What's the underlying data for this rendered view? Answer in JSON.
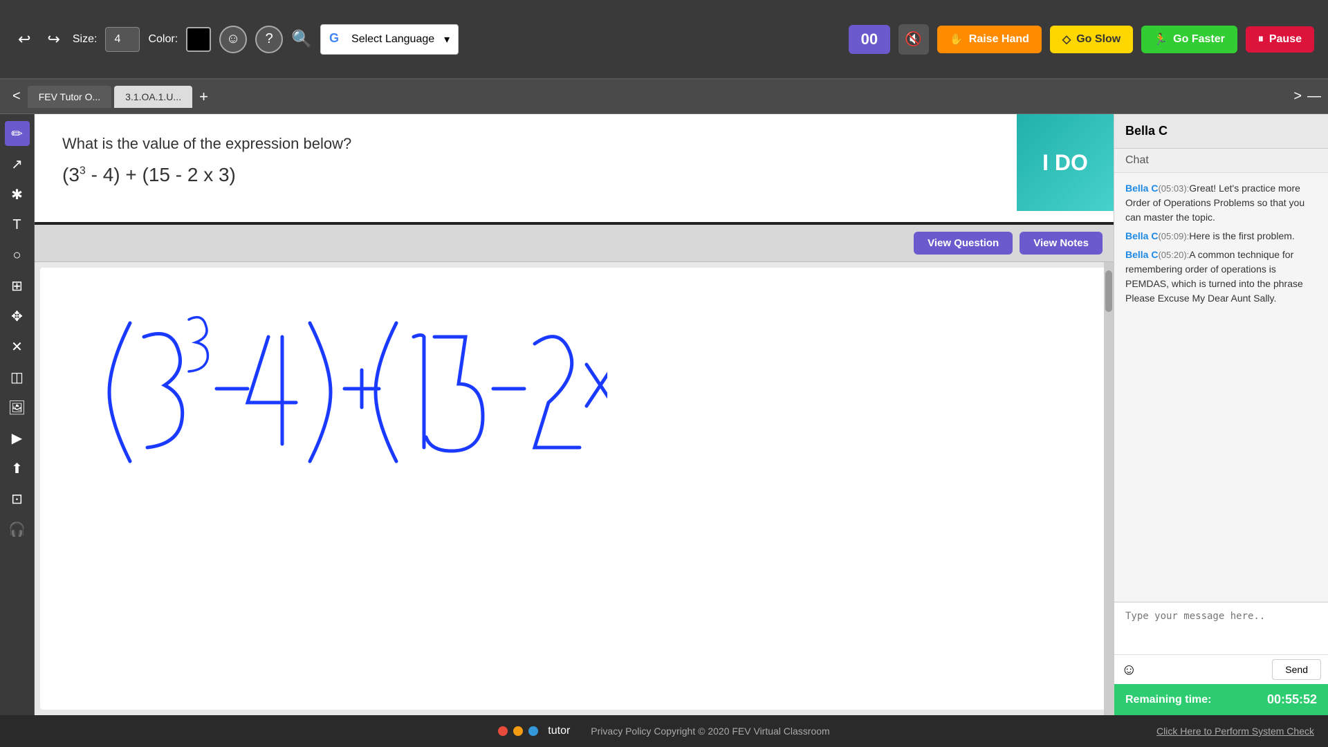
{
  "toolbar": {
    "undo_label": "↩",
    "redo_label": "↪",
    "size_label": "Size:",
    "size_value": "4",
    "color_label": "Color:",
    "emoji_label": "☺",
    "help_label": "?",
    "search_label": "🔍",
    "language_label": "Select Language",
    "language_dropdown": "▾",
    "timer_value": "00",
    "mute_label": "🔇",
    "raise_hand_label": "Raise Hand",
    "raise_hand_icon": "✋",
    "go_slow_label": "Go Slow",
    "go_slow_icon": "◇",
    "go_faster_label": "Go Faster",
    "go_faster_icon": "🏃",
    "pause_label": "Pause",
    "pause_icon": "⏸"
  },
  "tabs": {
    "prev_label": "<",
    "next_label": ">",
    "tab1_label": "FEV Tutor O...",
    "tab2_label": "3.1.OA.1.U...",
    "add_label": "+",
    "minimize_label": "—"
  },
  "left_tools": {
    "pencil": "✏",
    "arrow": "↗",
    "star": "✱",
    "text": "T",
    "circle": "○",
    "grid": "⊞",
    "move": "✥",
    "close": "✕",
    "eraser": "◫",
    "image": "🖼",
    "video": "▶",
    "upload": "⬆",
    "layout": "⊡",
    "headset": "🎧"
  },
  "question": {
    "title": "What is the value of the expression below?",
    "expression": "(3³ - 4) + (15 - 2 x 3)",
    "ido_label": "I DO"
  },
  "whiteboard": {
    "view_question_label": "View Question",
    "view_notes_label": "View Notes"
  },
  "chat": {
    "user_name": "Bella C",
    "chat_label": "Chat",
    "messages": [
      {
        "user": "Bella C",
        "time": "05:03",
        "text": "Great! Let's practice more Order of Operations Problems so that you can master the topic."
      },
      {
        "user": "Bella C",
        "time": "05:09",
        "text": "Here is the first problem."
      },
      {
        "user": "Bella C",
        "time": "05:20",
        "text": "A common technique for remembering order of operations is PEMDAS, which is turned into the phrase Please Excuse My Dear Aunt Sally."
      }
    ],
    "message_placeholder": "Type your message here..",
    "send_label": "Send",
    "remaining_time_label": "Remaining time:",
    "timer_value": "00:55:52"
  },
  "footer": {
    "logo_dots": [
      "red",
      "yellow",
      "blue"
    ],
    "logo_text": "tutor",
    "copyright": "Privacy Policy  Copyright © 2020 FEV Virtual Classroom",
    "system_check": "Click Here to Perform System Check"
  }
}
